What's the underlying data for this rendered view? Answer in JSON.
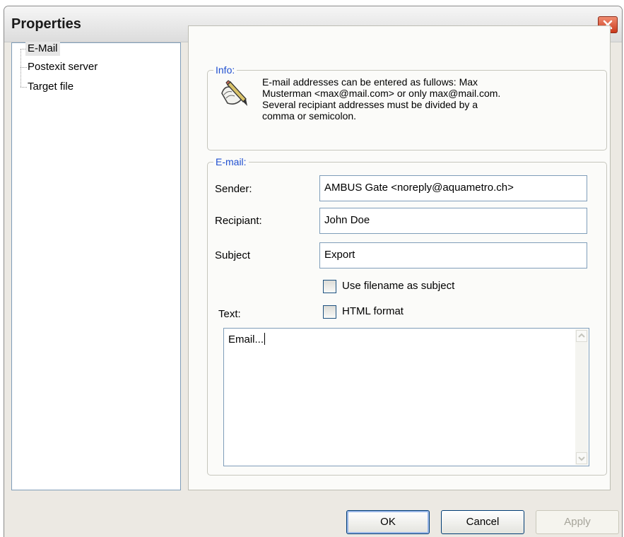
{
  "window": {
    "title": "Properties"
  },
  "tree": {
    "items": [
      {
        "label": "E-Mail"
      },
      {
        "label": "Postexit server"
      },
      {
        "label": "Target file"
      }
    ]
  },
  "info": {
    "group_label": "Info:",
    "lines": [
      "E-mail addresses can be entered as fullows: Max",
      "Musterman <max@mail.com> or only max@mail.com.",
      "Several recipiant addresses must be divided by a",
      "comma or semicolon."
    ]
  },
  "email": {
    "group_label": "E-mail:",
    "sender_label": "Sender:",
    "sender_value": "AMBUS Gate <noreply@aquametro.ch>",
    "recipient_label": "Recipiant:",
    "recipient_value": "John Doe",
    "subject_label": "Subject",
    "subject_value": "Export",
    "use_filename_label": "Use filename as subject",
    "text_label": "Text:",
    "html_format_label": "HTML format",
    "body_text": "Email..."
  },
  "buttons": {
    "ok": "OK",
    "cancel": "Cancel",
    "apply": "Apply"
  }
}
